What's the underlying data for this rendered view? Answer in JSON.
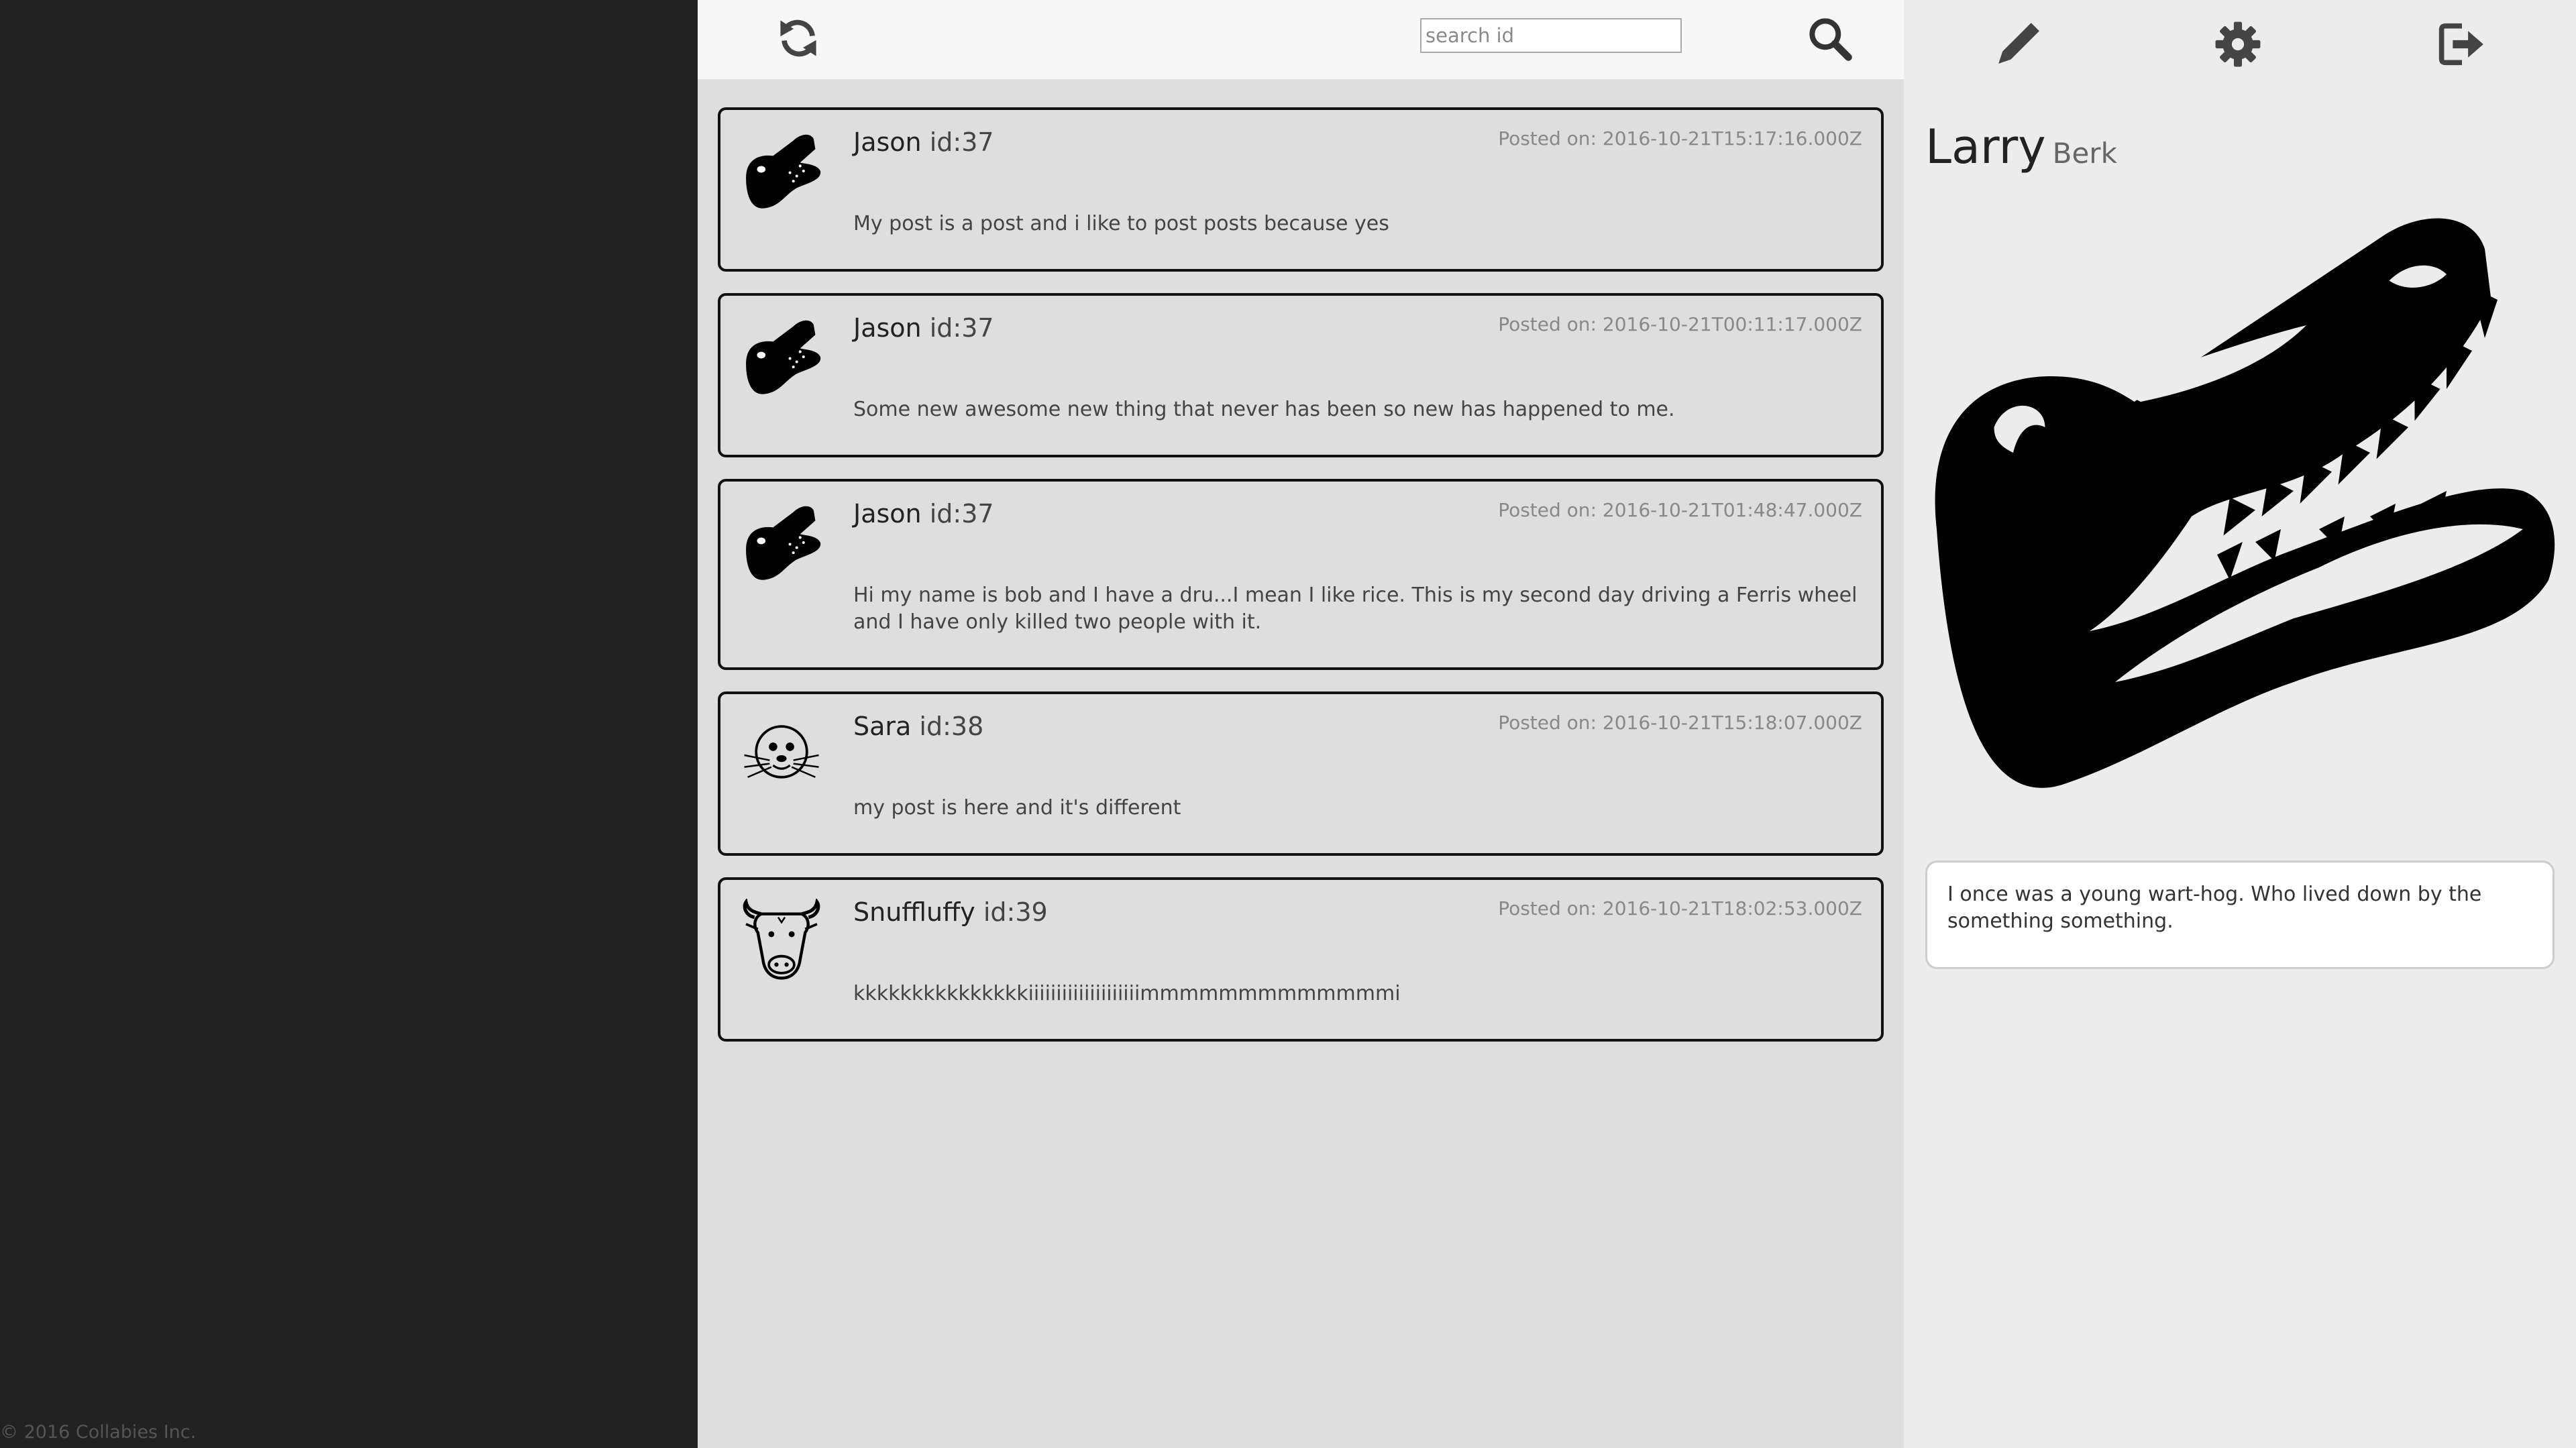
{
  "footer": {
    "copyright": "© 2016 Collabies Inc."
  },
  "header": {
    "refresh_icon": "refresh-icon",
    "search_placeholder": "search id",
    "search_value": "",
    "search_icon": "search-icon"
  },
  "posts": [
    {
      "author": "Jason",
      "author_id": "id:37",
      "date": "Posted on: 2016-10-21T15:17:16.000Z",
      "body": "My post is a post and i like to post posts because yes",
      "avatar_icon": "crocodile-icon"
    },
    {
      "author": "Jason",
      "author_id": "id:37",
      "date": "Posted on: 2016-10-21T00:11:17.000Z",
      "body": "Some new awesome new thing that never has been so new has happened to me.",
      "avatar_icon": "crocodile-icon"
    },
    {
      "author": "Jason",
      "author_id": "id:37",
      "date": "Posted on: 2016-10-21T01:48:47.000Z",
      "body": "Hi my name is bob and I have a dru...I mean I like rice. This is my second day driving a Ferris wheel and I have only killed two people with it.",
      "avatar_icon": "crocodile-icon"
    },
    {
      "author": "Sara",
      "author_id": "id:38",
      "date": "Posted on: 2016-10-21T15:18:07.000Z",
      "body": "my post is here and it's different",
      "avatar_icon": "seal-icon"
    },
    {
      "author": "Snuffluffy",
      "author_id": "id:39",
      "date": "Posted on: 2016-10-21T18:02:53.000Z",
      "body": "kkkkkkkkkkkkkkkiiiiiiiiiiiiiiiiiiiimmmmmmmmmmmmmi",
      "avatar_icon": "bull-icon"
    }
  ],
  "profile": {
    "first_name": "Larry",
    "last_name": "Berk",
    "bio": "I once was a young wart-hog. Who lived down by the something something.",
    "picture_icon": "crocodile-icon",
    "edit_icon": "pencil-icon",
    "settings_icon": "gear-icon",
    "logout_icon": "logout-icon"
  },
  "colors": {
    "sidebar": "#222222",
    "feed_background": "#dedede",
    "header_background": "#f7f7f7",
    "profile_background": "#ececec",
    "post_border": "#111111"
  }
}
